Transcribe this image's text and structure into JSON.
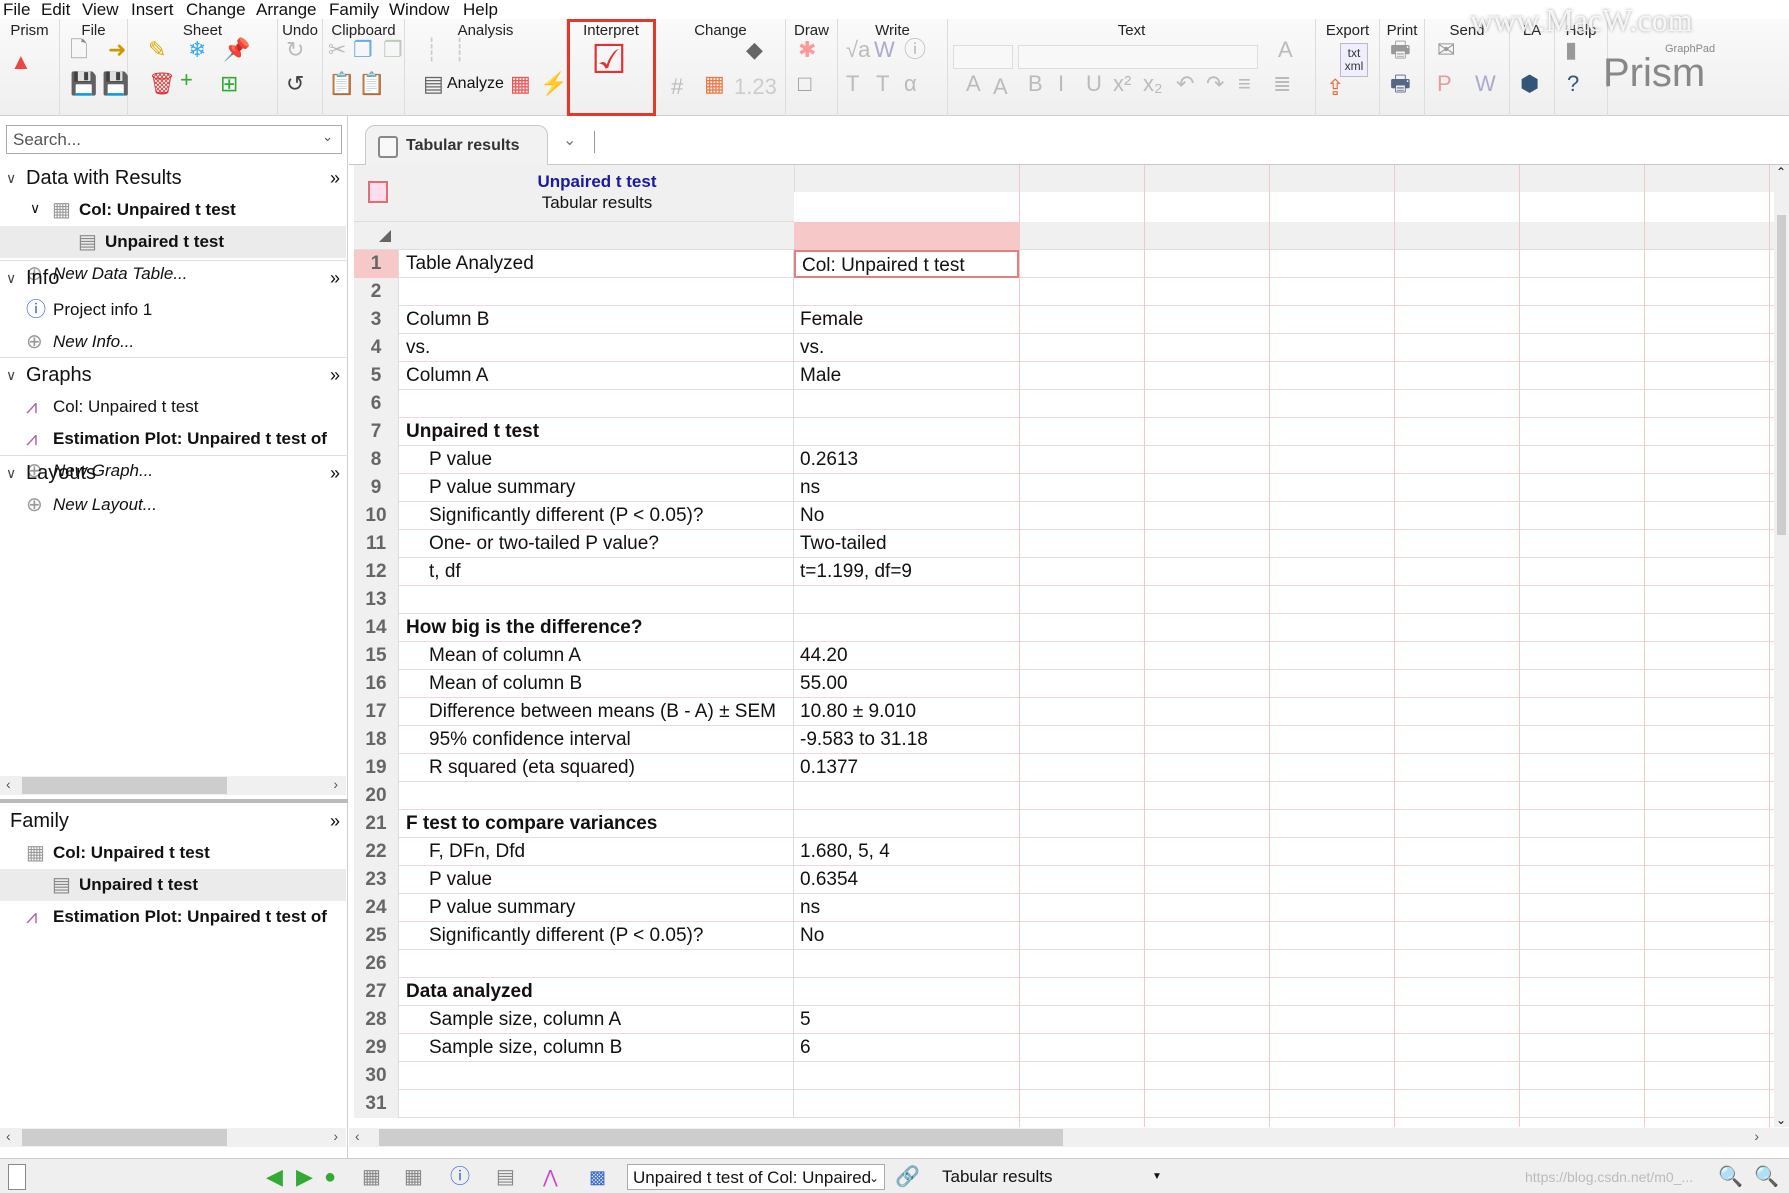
{
  "menu": [
    "File",
    "Edit",
    "View",
    "Insert",
    "Change",
    "Arrange",
    "Family",
    "Window",
    "Help"
  ],
  "ribbon": {
    "groups": [
      "Prism",
      "File",
      "Sheet",
      "Undo",
      "Clipboard",
      "Analysis",
      "Interpret",
      "Change",
      "Draw",
      "Write",
      "Text",
      "Export",
      "Print",
      "Send",
      "LA",
      "Help"
    ],
    "analyze_label": "Analyze",
    "export_icon_text": "txt xml",
    "logo_small": "GraphPad",
    "logo": "Prism",
    "watermark": "www.MacW.com",
    "highlight_color": "#e03a2a"
  },
  "sidebar": {
    "search_placeholder": "Search...",
    "sections": [
      {
        "label": "Data with Results",
        "items": [
          {
            "label": "Col: Unpaired t test",
            "style": "bold",
            "icon": "data-table-icon"
          },
          {
            "label": "Unpaired t test",
            "style": "bold",
            "icon": "results-sheet-icon",
            "selected": true
          },
          {
            "label": "New Data Table...",
            "style": "italic",
            "icon": "plus-circle-icon"
          }
        ]
      },
      {
        "label": "Info",
        "items": [
          {
            "label": "Project info 1",
            "icon": "info-icon"
          },
          {
            "label": "New Info...",
            "style": "italic",
            "icon": "plus-circle-icon"
          }
        ]
      },
      {
        "label": "Graphs",
        "items": [
          {
            "label": "Col: Unpaired t test",
            "icon": "graph-icon"
          },
          {
            "label": "Estimation Plot: Unpaired t test of",
            "style": "bold",
            "icon": "graph-icon"
          },
          {
            "label": "New Graph...",
            "style": "italic",
            "icon": "plus-circle-icon"
          }
        ]
      },
      {
        "label": "Layouts",
        "items": [
          {
            "label": "New Layout...",
            "style": "italic",
            "icon": "plus-circle-icon"
          }
        ]
      }
    ],
    "family": {
      "label": "Family",
      "items": [
        {
          "label": "Col: Unpaired t test",
          "icon": "data-table-icon"
        },
        {
          "label": "Unpaired t test",
          "icon": "results-sheet-icon",
          "selected": true
        },
        {
          "label": "Estimation Plot: Unpaired t test of",
          "icon": "graph-icon"
        }
      ]
    }
  },
  "tab": {
    "label": "Tabular results"
  },
  "sheet": {
    "title": "Unpaired t test",
    "subtitle": "Tabular results",
    "rows": [
      [
        "Table Analyzed",
        "Col: Unpaired t test",
        0
      ],
      [
        "",
        "",
        0
      ],
      [
        "Column B",
        "Female",
        0
      ],
      [
        "vs.",
        "vs.",
        0
      ],
      [
        "Column A",
        "Male",
        0
      ],
      [
        "",
        "",
        0
      ],
      [
        "Unpaired t test",
        "",
        2
      ],
      [
        "P value",
        "0.2613",
        1
      ],
      [
        "P value summary",
        "ns",
        1
      ],
      [
        "Significantly different (P < 0.05)?",
        "No",
        1
      ],
      [
        "One- or two-tailed P value?",
        "Two-tailed",
        1
      ],
      [
        "t, df",
        "t=1.199, df=9",
        1
      ],
      [
        "",
        "",
        0
      ],
      [
        "How big is the difference?",
        "",
        2
      ],
      [
        "Mean of column A",
        "44.20",
        1
      ],
      [
        "Mean of column B",
        "55.00",
        1
      ],
      [
        "Difference between means (B - A) ± SEM",
        "10.80 ± 9.010",
        1
      ],
      [
        "95% confidence interval",
        "-9.583 to 31.18",
        1
      ],
      [
        "R squared (eta squared)",
        "0.1377",
        1
      ],
      [
        "",
        "",
        0
      ],
      [
        "F test to compare variances",
        "",
        2
      ],
      [
        "F, DFn, Dfd",
        "1.680, 5, 4",
        1
      ],
      [
        "P value",
        "0.6354",
        1
      ],
      [
        "P value summary",
        "ns",
        1
      ],
      [
        "Significantly different (P < 0.05)?",
        "No",
        1
      ],
      [
        "",
        "",
        0
      ],
      [
        "Data analyzed",
        "",
        2
      ],
      [
        "Sample size, column A",
        "5",
        1
      ],
      [
        "Sample size, column B",
        "6",
        1
      ],
      [
        "",
        "",
        0
      ],
      [
        "",
        "",
        0
      ]
    ]
  },
  "status": {
    "sheet_select": "Unpaired t test of Col: Unpaired",
    "sheet_type": "Tabular results",
    "watermark": "https://blog.csdn.net/m0_..."
  }
}
